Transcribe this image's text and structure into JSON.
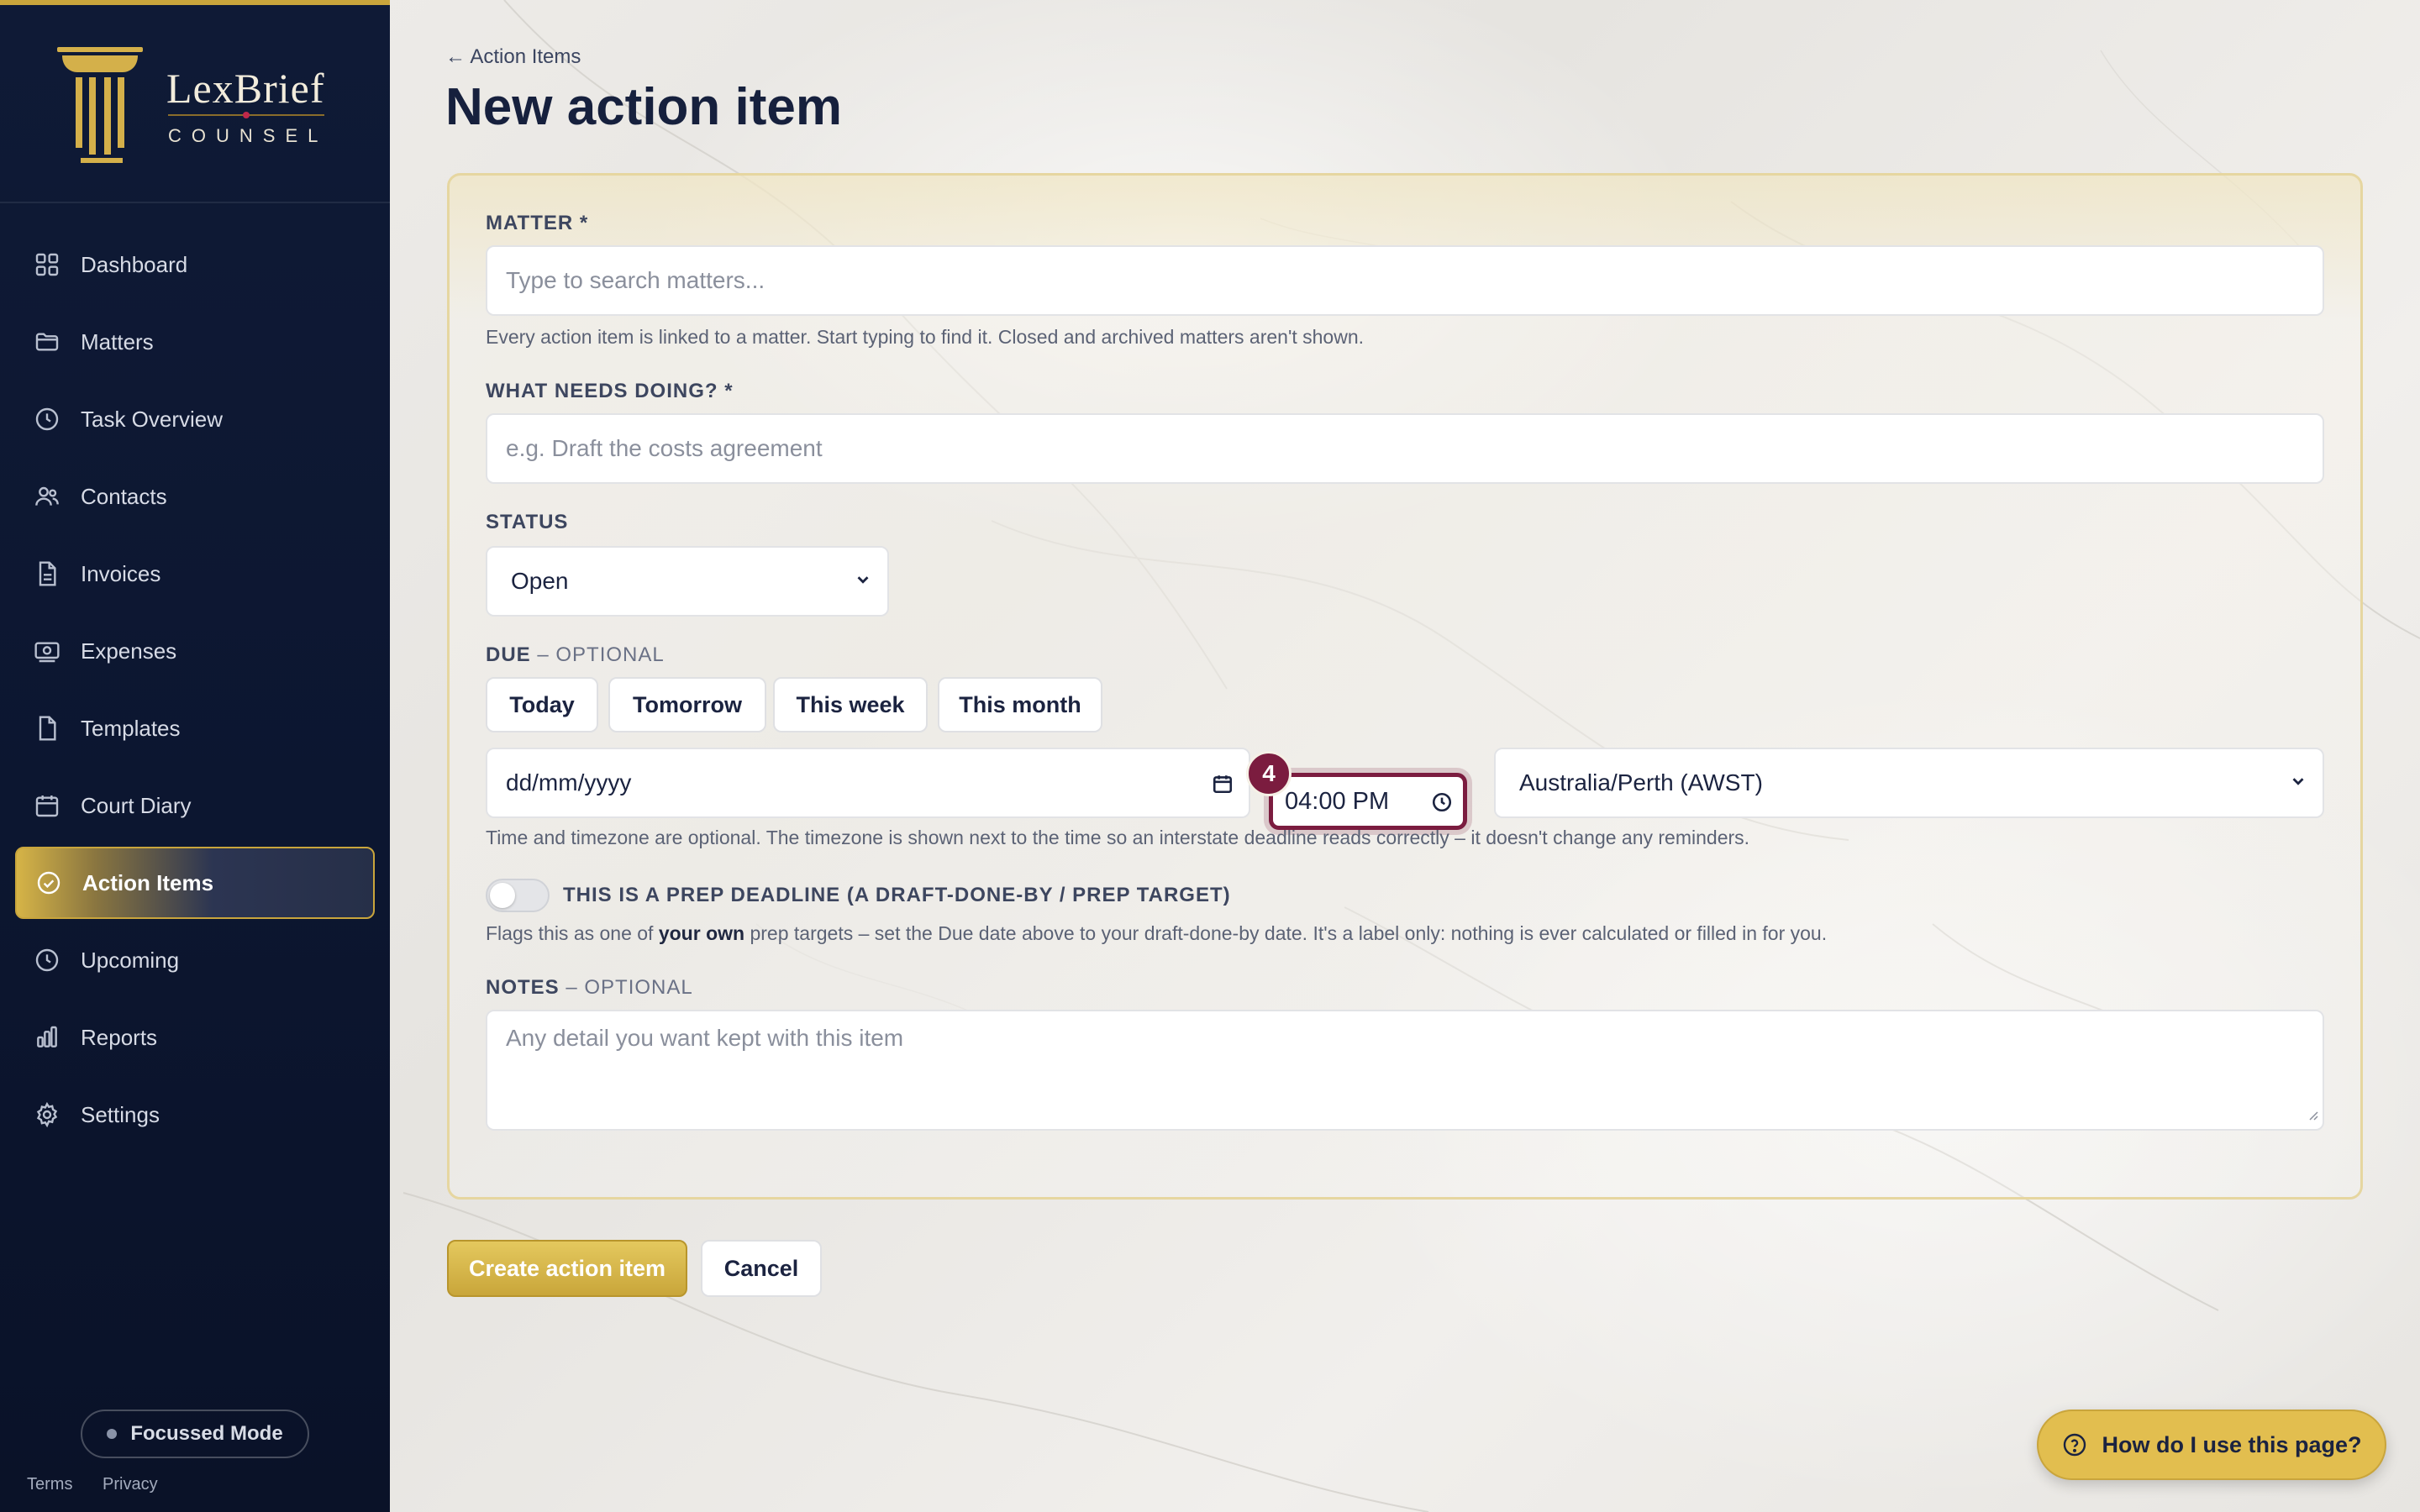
{
  "brand": {
    "name": "LexBrief",
    "sub": "COUNSEL"
  },
  "sidebar": {
    "items": [
      {
        "label": "Dashboard",
        "icon": "grid-icon"
      },
      {
        "label": "Matters",
        "icon": "folder-icon"
      },
      {
        "label": "Task Overview",
        "icon": "clock-icon"
      },
      {
        "label": "Contacts",
        "icon": "users-icon"
      },
      {
        "label": "Invoices",
        "icon": "document-icon"
      },
      {
        "label": "Expenses",
        "icon": "banknote-icon"
      },
      {
        "label": "Templates",
        "icon": "file-icon"
      },
      {
        "label": "Court Diary",
        "icon": "calendar-icon"
      },
      {
        "label": "Action Items",
        "icon": "check-circle-icon",
        "active": true
      },
      {
        "label": "Upcoming",
        "icon": "clock-icon"
      },
      {
        "label": "Reports",
        "icon": "bar-chart-icon"
      },
      {
        "label": "Settings",
        "icon": "gear-icon"
      }
    ],
    "focus_mode": "Focussed Mode",
    "footer": {
      "terms": "Terms",
      "privacy": "Privacy"
    }
  },
  "header": {
    "back": "← Action Items",
    "title": "New action item"
  },
  "form": {
    "matter": {
      "label": "MATTER *",
      "placeholder": "Type to search matters...",
      "help": "Every action item is linked to a matter. Start typing to find it. Closed and archived matters aren't shown."
    },
    "what": {
      "label": "WHAT NEEDS DOING? *",
      "placeholder": "e.g. Draft the costs agreement"
    },
    "status": {
      "label": "STATUS",
      "value": "Open"
    },
    "due": {
      "label": "DUE",
      "optional": " – OPTIONAL",
      "quick": [
        "Today",
        "Tomorrow",
        "This week",
        "This month"
      ],
      "date_placeholder": "dd/mm/yyyy",
      "time_value": "04:00 PM",
      "timezone": "Australia/Perth (AWST)",
      "help": "Time and timezone are optional. The timezone is shown next to the time so an interstate deadline reads correctly – it doesn't change any reminders."
    },
    "step_badge": "4",
    "prep": {
      "label": "THIS IS A PREP DEADLINE (A DRAFT-DONE-BY / PREP TARGET)",
      "help_before": "Flags this as one of ",
      "help_bold": "your own",
      "help_after": " prep targets – set the Due date above to your draft-done-by date. It's a label only: nothing is ever calculated or filled in for you.",
      "enabled": false
    },
    "notes": {
      "label": "NOTES",
      "optional": " – OPTIONAL",
      "placeholder": "Any detail you want kept with this item"
    }
  },
  "actions": {
    "create": "Create action item",
    "cancel": "Cancel"
  },
  "help_button": "How do I use this page?",
  "colors": {
    "navy": "#0f1a36",
    "gold": "#c9a53c",
    "focus": "#7b1c3f"
  }
}
